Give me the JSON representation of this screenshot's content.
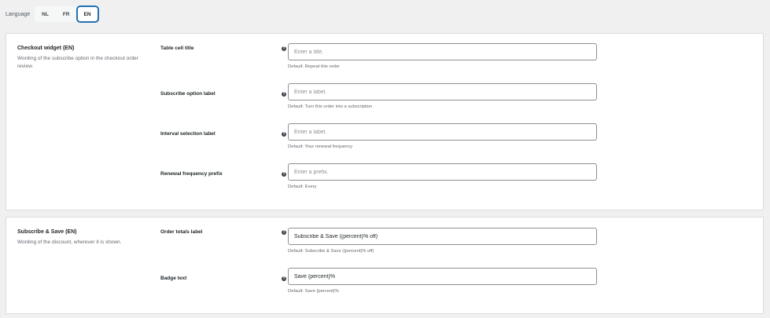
{
  "language": {
    "label": "Language",
    "options": [
      "NL",
      "FR",
      "EN"
    ],
    "selected": "EN"
  },
  "sections": [
    {
      "title": "Checkout widget (EN)",
      "description": "Wording of the subscribe option in the checkout order review.",
      "fields": [
        {
          "label": "Table cell title",
          "value": "",
          "placeholder": "Enter a title.",
          "hint": "Default: Repeat this order"
        },
        {
          "label": "Subscribe option label",
          "value": "",
          "placeholder": "Enter a label.",
          "hint": "Default: Turn this order into a subscription"
        },
        {
          "label": "Interval selection label",
          "value": "",
          "placeholder": "Enter a label.",
          "hint": "Default: Your renewal frequency"
        },
        {
          "label": "Renewal frequency prefix",
          "value": "",
          "placeholder": "Enter a prefix.",
          "hint": "Default: Every"
        }
      ]
    },
    {
      "title": "Subscribe & Save (EN)",
      "description": "Wording of the discount, wherever it is shown.",
      "fields": [
        {
          "label": "Order totals label",
          "value": "Subscribe & Save ({percent}% off)",
          "placeholder": "",
          "hint": "Default: Subscribe & Save ({percent}% off)"
        },
        {
          "label": "Badge text",
          "value": "Save {percent}%",
          "placeholder": "",
          "hint": "Default: Save {percent}%"
        }
      ]
    }
  ],
  "colors": {
    "accent": "#2271b1",
    "background": "#f0f0f1",
    "card": "#ffffff"
  },
  "icons": {
    "help": "question-circle-icon"
  }
}
